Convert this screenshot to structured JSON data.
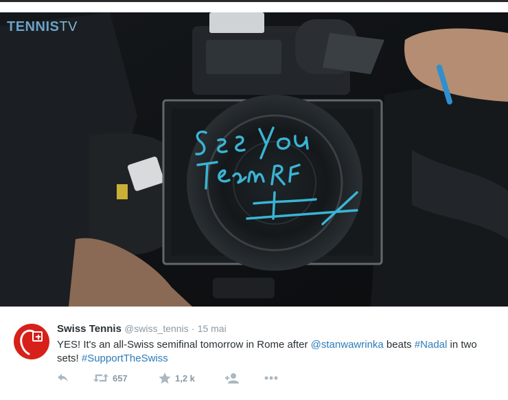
{
  "media": {
    "watermark_brand": "TENNIS",
    "watermark_tv": "TV",
    "handwriting_line1": "See You",
    "handwriting_line2": "Team RF"
  },
  "tweet": {
    "author_name": "Swiss Tennis",
    "author_handle": "@swiss_tennis",
    "separator": "·",
    "date": "15 mai",
    "text_1": "YES! It's an all-Swiss semifinal tomorrow in Rome after ",
    "mention": "@stanwawrinka",
    "text_2": " beats ",
    "hashtag_1": "#Nadal",
    "text_3": " in two sets! ",
    "hashtag_2": "#SupportTheSwiss",
    "retweet_count": "657",
    "favorite_count": "1,2 k"
  },
  "colors": {
    "link": "#2b7bb9",
    "marker": "#3ab4d4",
    "avatar": "#d8201a"
  },
  "icons": [
    "reply-icon",
    "retweet-icon",
    "star-icon",
    "follow-icon",
    "more-icon"
  ]
}
